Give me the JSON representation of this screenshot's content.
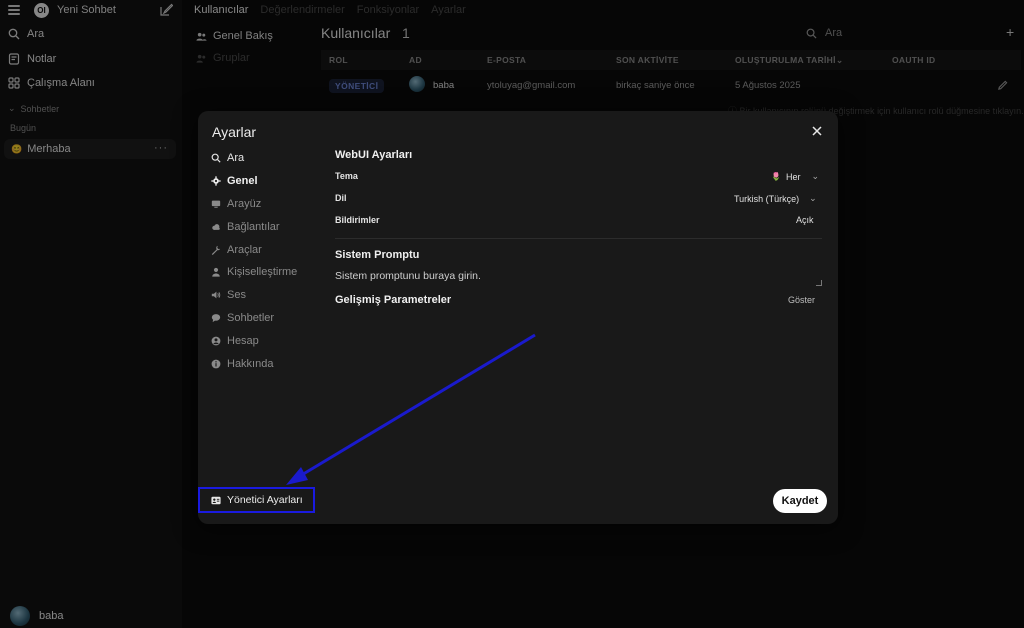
{
  "sidebar": {
    "new_chat": "Yeni Sohbet",
    "logo_text": "OI",
    "items": [
      {
        "label": "Ara",
        "icon": "search-icon"
      },
      {
        "label": "Notlar",
        "icon": "note-icon"
      },
      {
        "label": "Çalışma Alanı",
        "icon": "workspace-icon"
      }
    ],
    "section_chats": "Sohbetler",
    "section_today": "Bugün",
    "chat_item": {
      "emoji": "😊",
      "label": "Merhaba",
      "more": "···"
    },
    "user_name": "baba"
  },
  "topnav": {
    "tabs": [
      "Kullanıcılar",
      "Değerlendirmeler",
      "Fonksiyonlar",
      "Ayarlar"
    ]
  },
  "subnav": {
    "items": [
      "Genel Bakış",
      "Gruplar"
    ]
  },
  "users": {
    "title": "Kullanıcılar",
    "count": "1",
    "search_placeholder": "Ara",
    "add_label": "+",
    "columns": [
      "ROL",
      "AD",
      "E-POSTA",
      "SON AKTİVİTE",
      "OLUŞTURULMA TARİHİ",
      "OAUTH ID"
    ],
    "sort_indicator": "⌄",
    "row": {
      "role": "YÖNETİCİ",
      "name": "baba",
      "email": "ytoluyag@gmail.com",
      "last_active": "birkaç saniye önce",
      "created": "5 Ağustos 2025"
    },
    "hint": "ⓘ Bir kullanıcının rolünü değiştirmek için kullanıcı rolü düğmesine tıklayın."
  },
  "modal": {
    "title": "Ayarlar",
    "close_label": "✕",
    "nav": [
      {
        "label": "Ara",
        "icon": "search-icon"
      },
      {
        "label": "Genel",
        "icon": "gear-icon"
      },
      {
        "label": "Arayüz",
        "icon": "monitor-icon"
      },
      {
        "label": "Bağlantılar",
        "icon": "cloud-icon"
      },
      {
        "label": "Araçlar",
        "icon": "wrench-icon"
      },
      {
        "label": "Kişiselleştirme",
        "icon": "person-icon"
      },
      {
        "label": "Ses",
        "icon": "speaker-icon"
      },
      {
        "label": "Sohbetler",
        "icon": "chat-bubble-icon"
      },
      {
        "label": "Hesap",
        "icon": "account-icon"
      },
      {
        "label": "Hakkında",
        "icon": "info-icon"
      }
    ],
    "webui_heading": "WebUI Ayarları",
    "theme_label": "Tema",
    "theme_value": "Her",
    "theme_emoji": "🌷",
    "language_label": "Dil",
    "language_value": "Turkish (Türkçe)",
    "notifications_label": "Bildirimler",
    "notifications_value": "Açık",
    "system_prompt_heading": "Sistem Promptu",
    "system_prompt_placeholder": "Sistem promptunu buraya girin.",
    "advanced_heading": "Gelişmiş Parametreler",
    "advanced_toggle": "Göster",
    "admin_settings": "Yönetici Ayarları",
    "save": "Kaydet"
  },
  "colors": {
    "highlight_border": "#1a1adf",
    "arrow": "#1a1acc",
    "role_badge_text": "#6c83d3"
  }
}
